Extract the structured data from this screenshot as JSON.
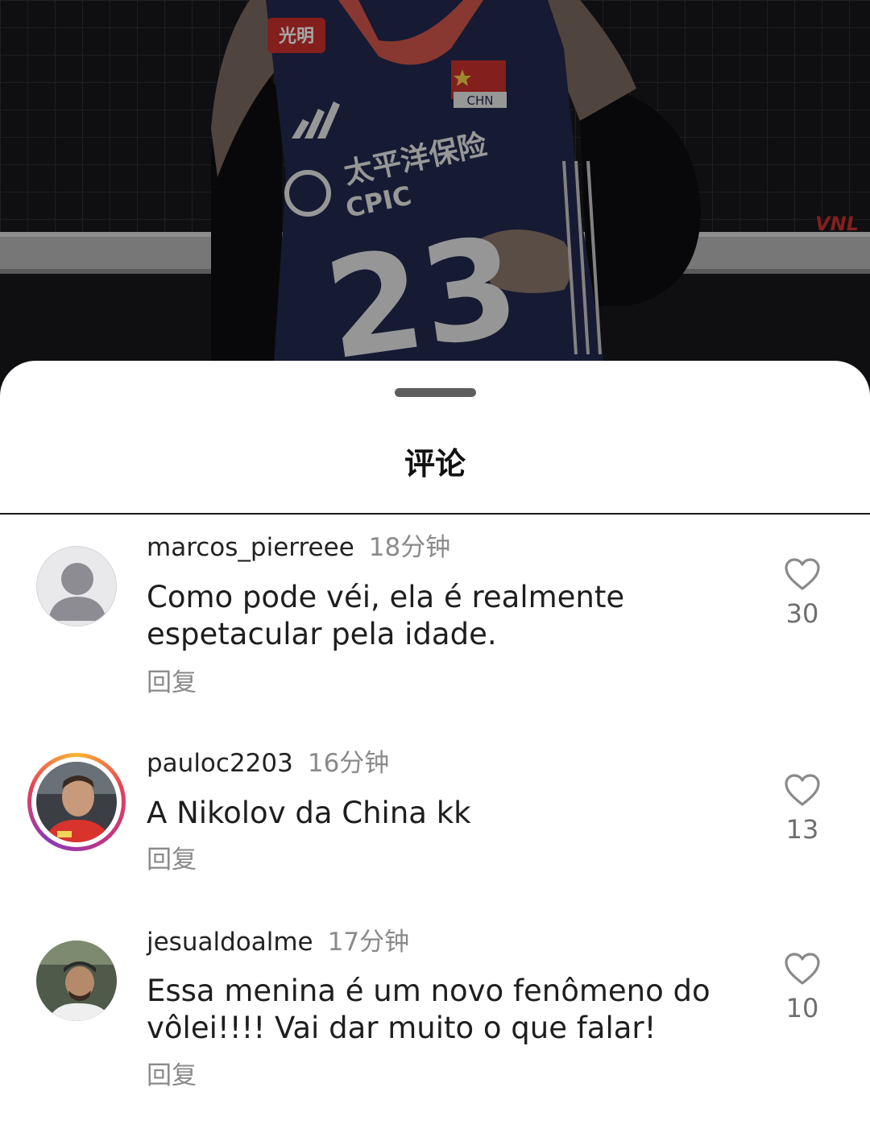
{
  "background": {
    "jersey_number": "23",
    "sponsor_cn": "太平洋保险",
    "sponsor_en": "CPIC",
    "chest_logo": "光明",
    "flag_label": "CHN",
    "net_logo": "VNL"
  },
  "sheet": {
    "title": "评论"
  },
  "comments": [
    {
      "username": "marcos_pierreee",
      "time": "18分钟",
      "text": "Como pode véi, ela é realmente espetacular pela idade.",
      "reply_label": "回复",
      "likes": "30",
      "avatar": "default-avatar"
    },
    {
      "username": "pauloc2203",
      "time": "16分钟",
      "text": "A Nikolov da China kk",
      "reply_label": "回复",
      "likes": "13",
      "avatar": "photo-avatar-story-ring"
    },
    {
      "username": "jesualdoalme",
      "time": "17分钟",
      "text": "Essa menina é um novo fenômeno do vôlei!!!! Vai dar muito o que falar!",
      "reply_label": "回复",
      "likes": "10",
      "avatar": "photo-avatar"
    }
  ],
  "icons": {
    "like": "heart-outline-icon"
  },
  "colors": {
    "sheet_bg": "#ffffff",
    "username": "#222222",
    "muted": "#8a8a8a",
    "jersey": "#23294f",
    "jersey_trim": "#d2574a"
  }
}
